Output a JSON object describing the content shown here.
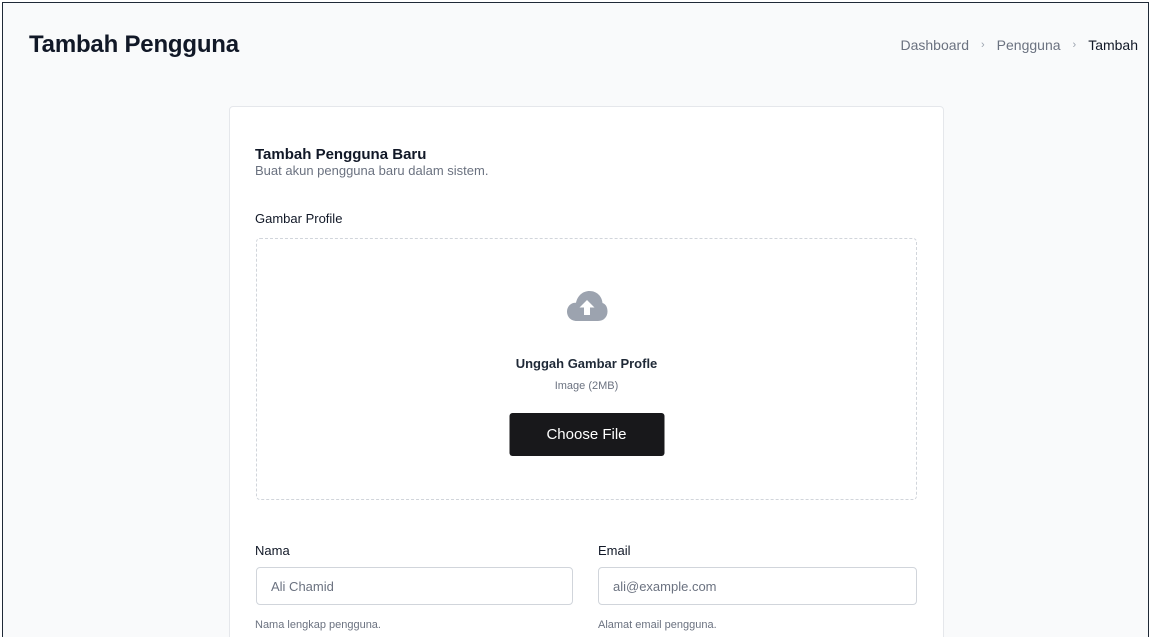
{
  "header": {
    "title": "Tambah Pengguna",
    "breadcrumb": {
      "items": [
        "Dashboard",
        "Pengguna"
      ],
      "current": "Tambah",
      "separator": "›"
    }
  },
  "form": {
    "title": "Tambah Pengguna Baru",
    "subtitle": "Buat akun pengguna baru dalam sistem.",
    "profile_image": {
      "label": "Gambar Profile",
      "icon": "cloud-upload-icon",
      "upload_title": "Unggah Gambar Profle",
      "upload_hint": "Image (2MB)",
      "button_label": "Choose File"
    },
    "name": {
      "label": "Nama",
      "placeholder": "Ali Chamid",
      "value": "",
      "help": "Nama lengkap pengguna."
    },
    "email": {
      "label": "Email",
      "placeholder": "ali@example.com",
      "value": "",
      "help": "Alamat email pengguna."
    }
  },
  "colors": {
    "background": "#f9fafb",
    "card": "#ffffff",
    "button": "#18181b",
    "icon": "#9ca3af"
  }
}
